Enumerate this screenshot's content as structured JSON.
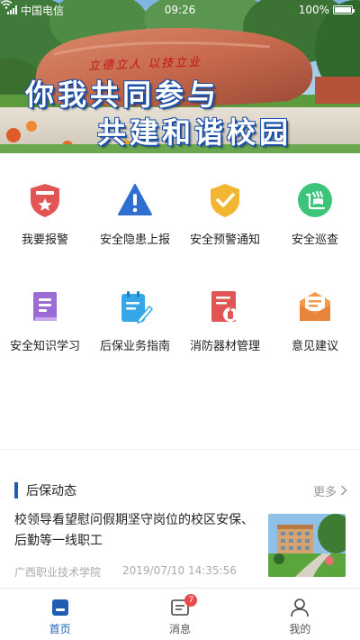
{
  "status_bar": {
    "carrier": "中国电信",
    "time": "09:26",
    "battery": "100%",
    "battery_level": 1.0
  },
  "banner": {
    "rock_text": "立德立人 以技立业",
    "slogan_line1": "你我共同参与",
    "slogan_line2": "共建和谐校园"
  },
  "grid": {
    "items": [
      {
        "label": "我要报警",
        "icon": "police-badge-icon",
        "color": "#e25555"
      },
      {
        "label": "安全隐患上报",
        "icon": "warning-triangle-icon",
        "color": "#2e6fd1"
      },
      {
        "label": "安全预警通知",
        "icon": "shield-check-icon",
        "color": "#f2b632"
      },
      {
        "label": "安全巡查",
        "icon": "patrol-icon",
        "color": "#3cc57a"
      },
      {
        "label": "安全知识学习",
        "icon": "book-icon",
        "color": "#9b6cd4"
      },
      {
        "label": "后保业务指南",
        "icon": "notepad-pen-icon",
        "color": "#35a7e8"
      },
      {
        "label": "消防器材管理",
        "icon": "fire-extinguisher-doc-icon",
        "color": "#e25555"
      },
      {
        "label": "意见建议",
        "icon": "mail-icon",
        "color": "#f29a4a"
      }
    ]
  },
  "news_section": {
    "title": "后保动态",
    "more_label": "更多",
    "accent_color": "#1e5fb4"
  },
  "news": [
    {
      "title": "校领导看望慰问假期坚守岗位的校区安保、后勤等一线职工",
      "source": "广西职业技术学院",
      "date": "2019/07/10 14:35:56"
    }
  ],
  "tabbar": {
    "tabs": [
      {
        "label": "首页",
        "icon": "home-icon",
        "active": true
      },
      {
        "label": "消息",
        "icon": "message-icon",
        "badge": "7"
      },
      {
        "label": "我的",
        "icon": "user-icon"
      }
    ]
  }
}
